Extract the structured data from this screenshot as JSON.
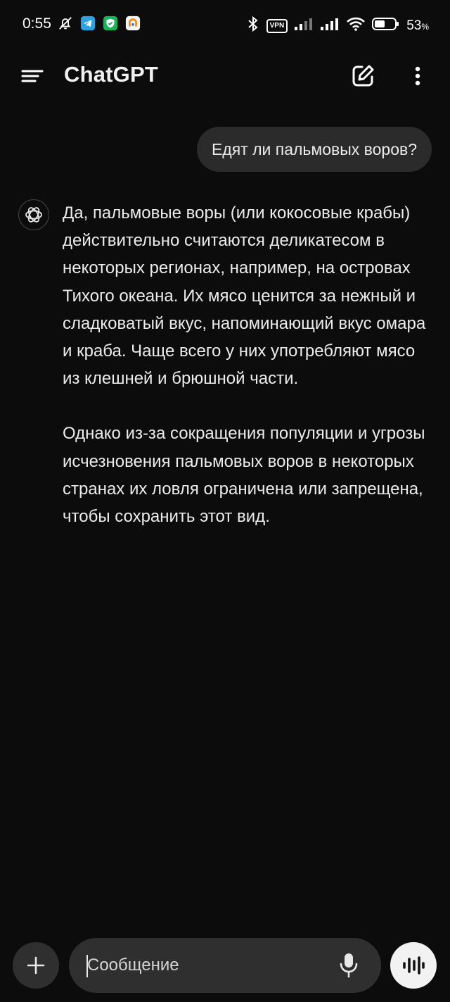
{
  "status_bar": {
    "time": "0:55",
    "vpn_label": "VPN",
    "battery_percent": "53",
    "battery_unit": "%",
    "battery_level": 0.53
  },
  "header": {
    "title": "ChatGPT",
    "icons": {
      "menu": "menu-icon",
      "new_chat": "edit-icon",
      "more": "more-vertical-icon"
    }
  },
  "conversation": {
    "user_message": "Едят ли пальмовых воров?",
    "assistant_message": {
      "paragraphs": [
        "Да, пальмовые воры (или кокосовые крабы) действительно считаются деликатесом в некоторых регионах, например, на островах Тихого океана. Их мясо ценится за нежный и сладковатый вкус, напоминающий вкус омара и краба. Чаще всего у них употребляют мясо из клешней и брюшной части.",
        "Однако из-за сокращения популяции и угрозы исчезновения пальмовых воров в некоторых странах их ловля ограничена или запрещена, чтобы сохранить этот вид."
      ]
    }
  },
  "composer": {
    "placeholder": "Сообщение",
    "value": ""
  },
  "colors": {
    "background": "#0c0c0c",
    "bubble": "#2b2b2b",
    "input": "#2f2f2f",
    "text": "#ececec"
  }
}
